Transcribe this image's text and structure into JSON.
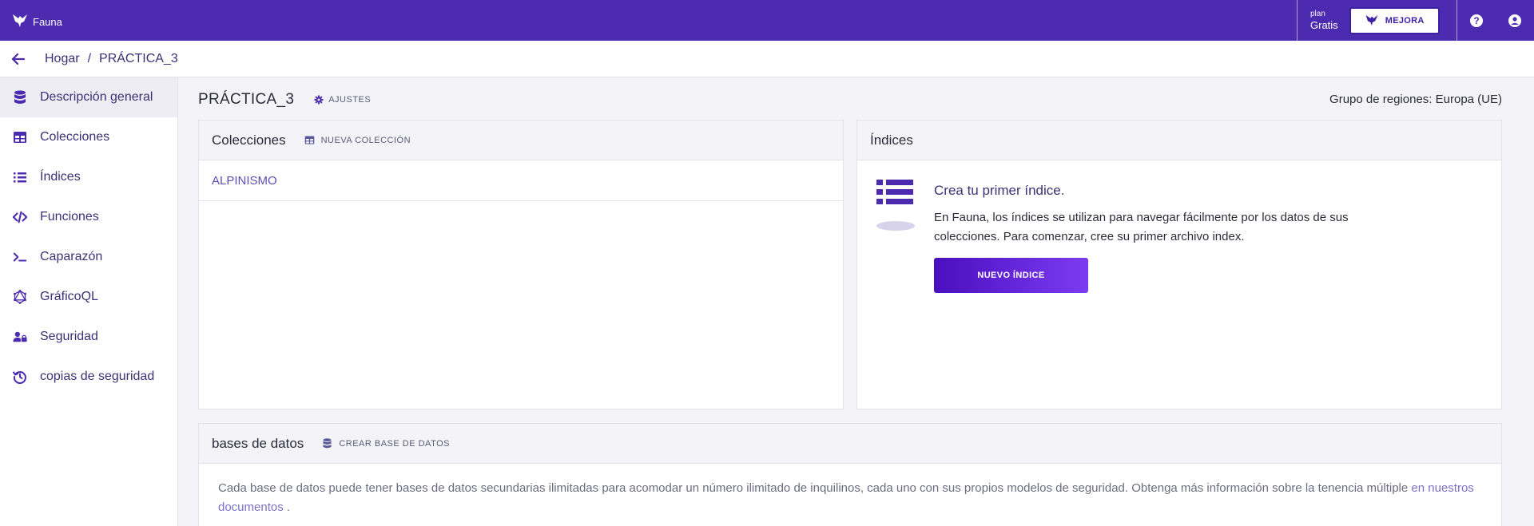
{
  "app": {
    "name": "Fauna"
  },
  "topbar": {
    "plan_label": "plan",
    "plan_value": "Gratis",
    "upgrade_label": "MEJORA",
    "help_icon": "question-circle-icon",
    "account_icon": "user-circle-icon"
  },
  "breadcrumb": {
    "home": "Hogar",
    "separator": "/",
    "current": "PRÁCTICA_3"
  },
  "sidebar": {
    "items": [
      {
        "label": "Descripción general",
        "icon": "database-icon",
        "active": true
      },
      {
        "label": "Colecciones",
        "icon": "table-icon",
        "active": false
      },
      {
        "label": "Índices",
        "icon": "list-icon",
        "active": false
      },
      {
        "label": "Funciones",
        "icon": "code-icon",
        "active": false
      },
      {
        "label": "Caparazón",
        "icon": "terminal-icon",
        "active": false
      },
      {
        "label": "GráficoQL",
        "icon": "graphql-icon",
        "active": false
      },
      {
        "label": "Seguridad",
        "icon": "user-lock-icon",
        "active": false
      },
      {
        "label": "copias de seguridad",
        "icon": "history-icon",
        "active": false
      }
    ]
  },
  "main": {
    "title": "PRÁCTICA_3",
    "settings_label": "AJUSTES",
    "region": "Grupo de regiones: Europa (UE)"
  },
  "collections_card": {
    "title": "Colecciones",
    "action_label": "NUEVA COLECCIÓN",
    "items": [
      "ALPINISMO"
    ]
  },
  "indexes_card": {
    "title": "Índices",
    "heading": "Crea tu primer índice.",
    "description": "En Fauna, los índices se utilizan para navegar fácilmente por los datos de sus colecciones. Para comenzar, cree su primer archivo index.",
    "button_label": "NUEVO ÍNDICE"
  },
  "databases_card": {
    "title": "bases de datos",
    "action_label": "CREAR BASE DE DATOS",
    "text": "Cada base de datos puede tener bases de datos secundarias ilimitadas para acomodar un número ilimitado de inquilinos, cada uno con sus propios modelos de seguridad. Obtenga más información sobre la tenencia múltiple",
    "link_text": "en nuestros documentos",
    "trailing": " ."
  },
  "colors": {
    "brand": "#4c2bb0",
    "accent_text": "#3b3175",
    "button_gradient_start": "#4a0fbf",
    "button_gradient_end": "#7d3bef"
  }
}
